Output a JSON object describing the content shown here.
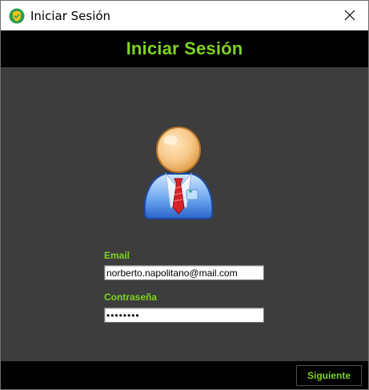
{
  "window": {
    "title": "Iniciar Sesión",
    "icon": "shield-check-icon",
    "close_icon": "close-icon"
  },
  "header": {
    "title": "Iniciar Sesión"
  },
  "avatar": {
    "icon": "user-avatar-icon"
  },
  "form": {
    "email_label": "Email",
    "email_value": "norberto.napolitano@mail.com",
    "password_label": "Contraseña",
    "password_value": "••••••••"
  },
  "footer": {
    "next_label": "Siguiente"
  },
  "colors": {
    "accent": "#7ed321",
    "header_bg": "#000000",
    "content_bg": "#3d3d3d"
  }
}
